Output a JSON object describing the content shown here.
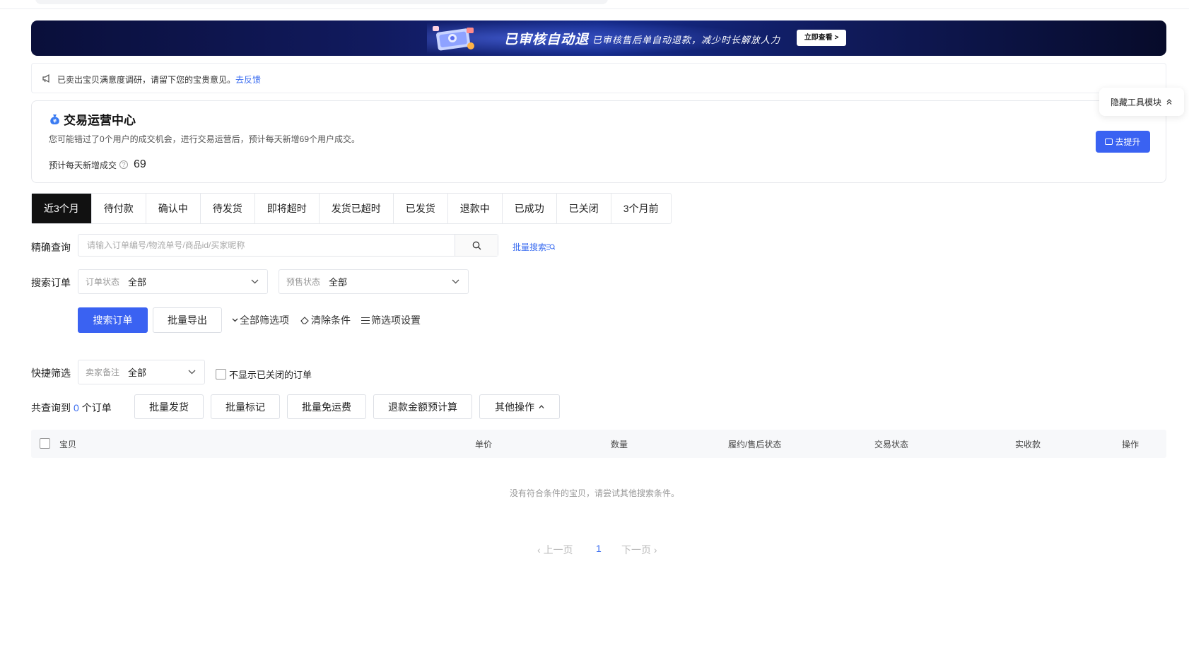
{
  "banner": {
    "title": "已审核自动退",
    "subtitle": "已审核售后单自动退款，减少时长解放人力",
    "cta": "立即查看 >"
  },
  "notice": {
    "text": "已卖出宝贝满意度调研，请留下您的宝贵意见。",
    "link": "去反馈"
  },
  "ops_center": {
    "title": "交易运营中心",
    "desc": "您可能错过了0个用户的成交机会，进行交易运营后，预计每天新增69个用户成交。",
    "metric_label": "预计每天新增成交",
    "metric_value": "69",
    "button": "去提升"
  },
  "float_tool": {
    "label": "隐藏工具模块"
  },
  "tabs": [
    "近3个月",
    "待付款",
    "确认中",
    "待发货",
    "即将超时",
    "发货已超时",
    "已发货",
    "退款中",
    "已成功",
    "已关闭",
    "3个月前"
  ],
  "precise_query": {
    "label": "精确查询",
    "placeholder": "请输入订单编号/物流单号/商品id/买家昵称",
    "batch_search": "批量搜索"
  },
  "search_orders": {
    "label": "搜索订单",
    "order_status_key": "订单状态",
    "order_status_value": "全部",
    "presale_status_key": "预售状态",
    "presale_status_value": "全部"
  },
  "actions": {
    "search": "搜索订单",
    "export": "批量导出",
    "all_filters": "全部筛选项",
    "clear": "清除条件",
    "filter_settings": "筛选项设置"
  },
  "quick_filter": {
    "label": "快捷筛选",
    "note_key": "卖家备注",
    "note_value": "全部",
    "hide_closed": "不显示已关闭的订单"
  },
  "result": {
    "prefix": "共查询到",
    "count": "0",
    "suffix": "个订单",
    "bulk_ship": "批量发货",
    "bulk_mark": "批量标记",
    "bulk_free_ship": "批量免运费",
    "refund_estimate": "退款金额预计算",
    "other_ops": "其他操作"
  },
  "table": {
    "columns": [
      "宝贝",
      "单价",
      "数量",
      "履约/售后状态",
      "交易状态",
      "实收款",
      "操作"
    ],
    "empty": "没有符合条件的宝贝，请尝试其他搜索条件。"
  },
  "pagination": {
    "prev": "上一页",
    "current": "1",
    "next": "下一页"
  }
}
